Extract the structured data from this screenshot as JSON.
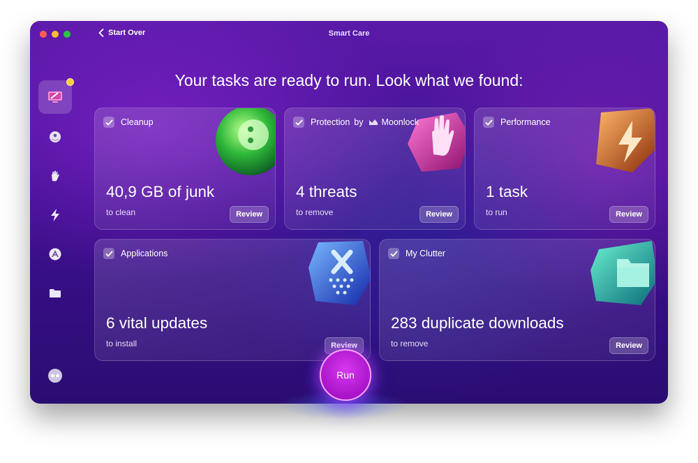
{
  "window": {
    "title": "Smart Care",
    "back_label": "Start Over"
  },
  "headline": "Your tasks are ready to run. Look what we found:",
  "sidebar": {
    "items": [
      {
        "icon": "cleanup-screen-icon",
        "active": true,
        "badge": true
      },
      {
        "icon": "shield-ball-icon"
      },
      {
        "icon": "hand-icon"
      },
      {
        "icon": "lightning-icon"
      },
      {
        "icon": "app-store-icon"
      },
      {
        "icon": "folder-icon"
      },
      {
        "icon": "assistant-icon"
      }
    ]
  },
  "cards": {
    "cleanup": {
      "title": "Cleanup",
      "value": "40,9 GB of junk",
      "sub": "to clean",
      "review": "Review"
    },
    "protection": {
      "title": "Protection",
      "by": "by",
      "brand": "Moonlock",
      "value": "4 threats",
      "sub": "to remove",
      "review": "Review"
    },
    "performance": {
      "title": "Performance",
      "value": "1 task",
      "sub": "to run",
      "review": "Review"
    },
    "applications": {
      "title": "Applications",
      "value": "6 vital updates",
      "sub": "to install",
      "review": "Review"
    },
    "clutter": {
      "title": "My Clutter",
      "value": "283 duplicate downloads",
      "sub": "to remove",
      "review": "Review"
    }
  },
  "run_label": "Run",
  "colors": {
    "accent": "#c020e0",
    "badge": "#ffcc33",
    "close": "#ff5f57",
    "minimize": "#febc2e",
    "zoom": "#28c840"
  }
}
